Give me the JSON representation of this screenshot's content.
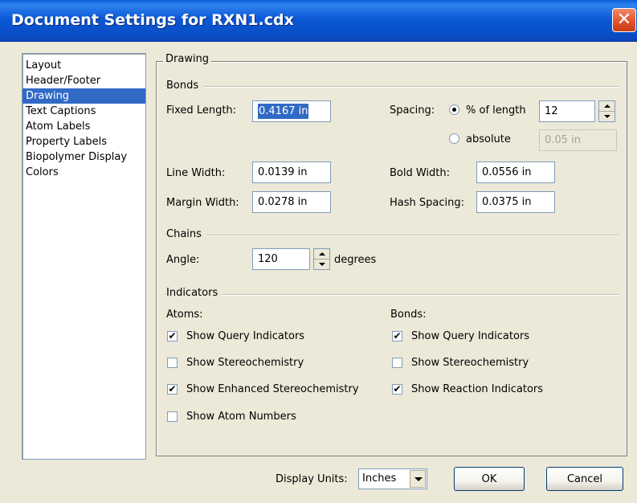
{
  "window": {
    "title": "Document Settings for RXN1.cdx",
    "close_label": "✕"
  },
  "sidebar": {
    "items": [
      {
        "label": "Layout"
      },
      {
        "label": "Header/Footer"
      },
      {
        "label": "Drawing",
        "selected": true
      },
      {
        "label": "Text Captions"
      },
      {
        "label": "Atom Labels"
      },
      {
        "label": "Property Labels"
      },
      {
        "label": "Biopolymer Display"
      },
      {
        "label": "Colors"
      }
    ]
  },
  "drawing": {
    "group_title": "Drawing",
    "bonds_section": "Bonds",
    "fixed_length_label": "Fixed Length:",
    "fixed_length_value": "0.4167 in",
    "spacing_label": "Spacing:",
    "spacing_percent_label": "% of length",
    "spacing_percent_value": "12",
    "spacing_absolute_label": "absolute",
    "spacing_absolute_value": "0.05 in",
    "line_width_label": "Line Width:",
    "line_width_value": "0.0139 in",
    "bold_width_label": "Bold Width:",
    "bold_width_value": "0.0556 in",
    "margin_width_label": "Margin Width:",
    "margin_width_value": "0.0278 in",
    "hash_spacing_label": "Hash Spacing:",
    "hash_spacing_value": "0.0375 in",
    "chains_section": "Chains",
    "angle_label": "Angle:",
    "angle_value": "120",
    "angle_unit": "degrees",
    "indicators_section": "Indicators",
    "atoms_label": "Atoms:",
    "bonds_label": "Bonds:",
    "atoms_checks": [
      {
        "label": "Show Query Indicators",
        "checked": true
      },
      {
        "label": "Show Stereochemistry",
        "checked": false
      },
      {
        "label": "Show Enhanced Stereochemistry",
        "checked": true
      },
      {
        "label": "Show Atom Numbers",
        "checked": false
      }
    ],
    "bonds_checks": [
      {
        "label": "Show Query Indicators",
        "checked": true
      },
      {
        "label": "Show Stereochemistry",
        "checked": false
      },
      {
        "label": "Show Reaction Indicators",
        "checked": true
      }
    ]
  },
  "footer": {
    "display_units_label": "Display Units:",
    "display_units_value": "Inches",
    "ok_label": "OK",
    "cancel_label": "Cancel"
  },
  "check_mark": "✔"
}
